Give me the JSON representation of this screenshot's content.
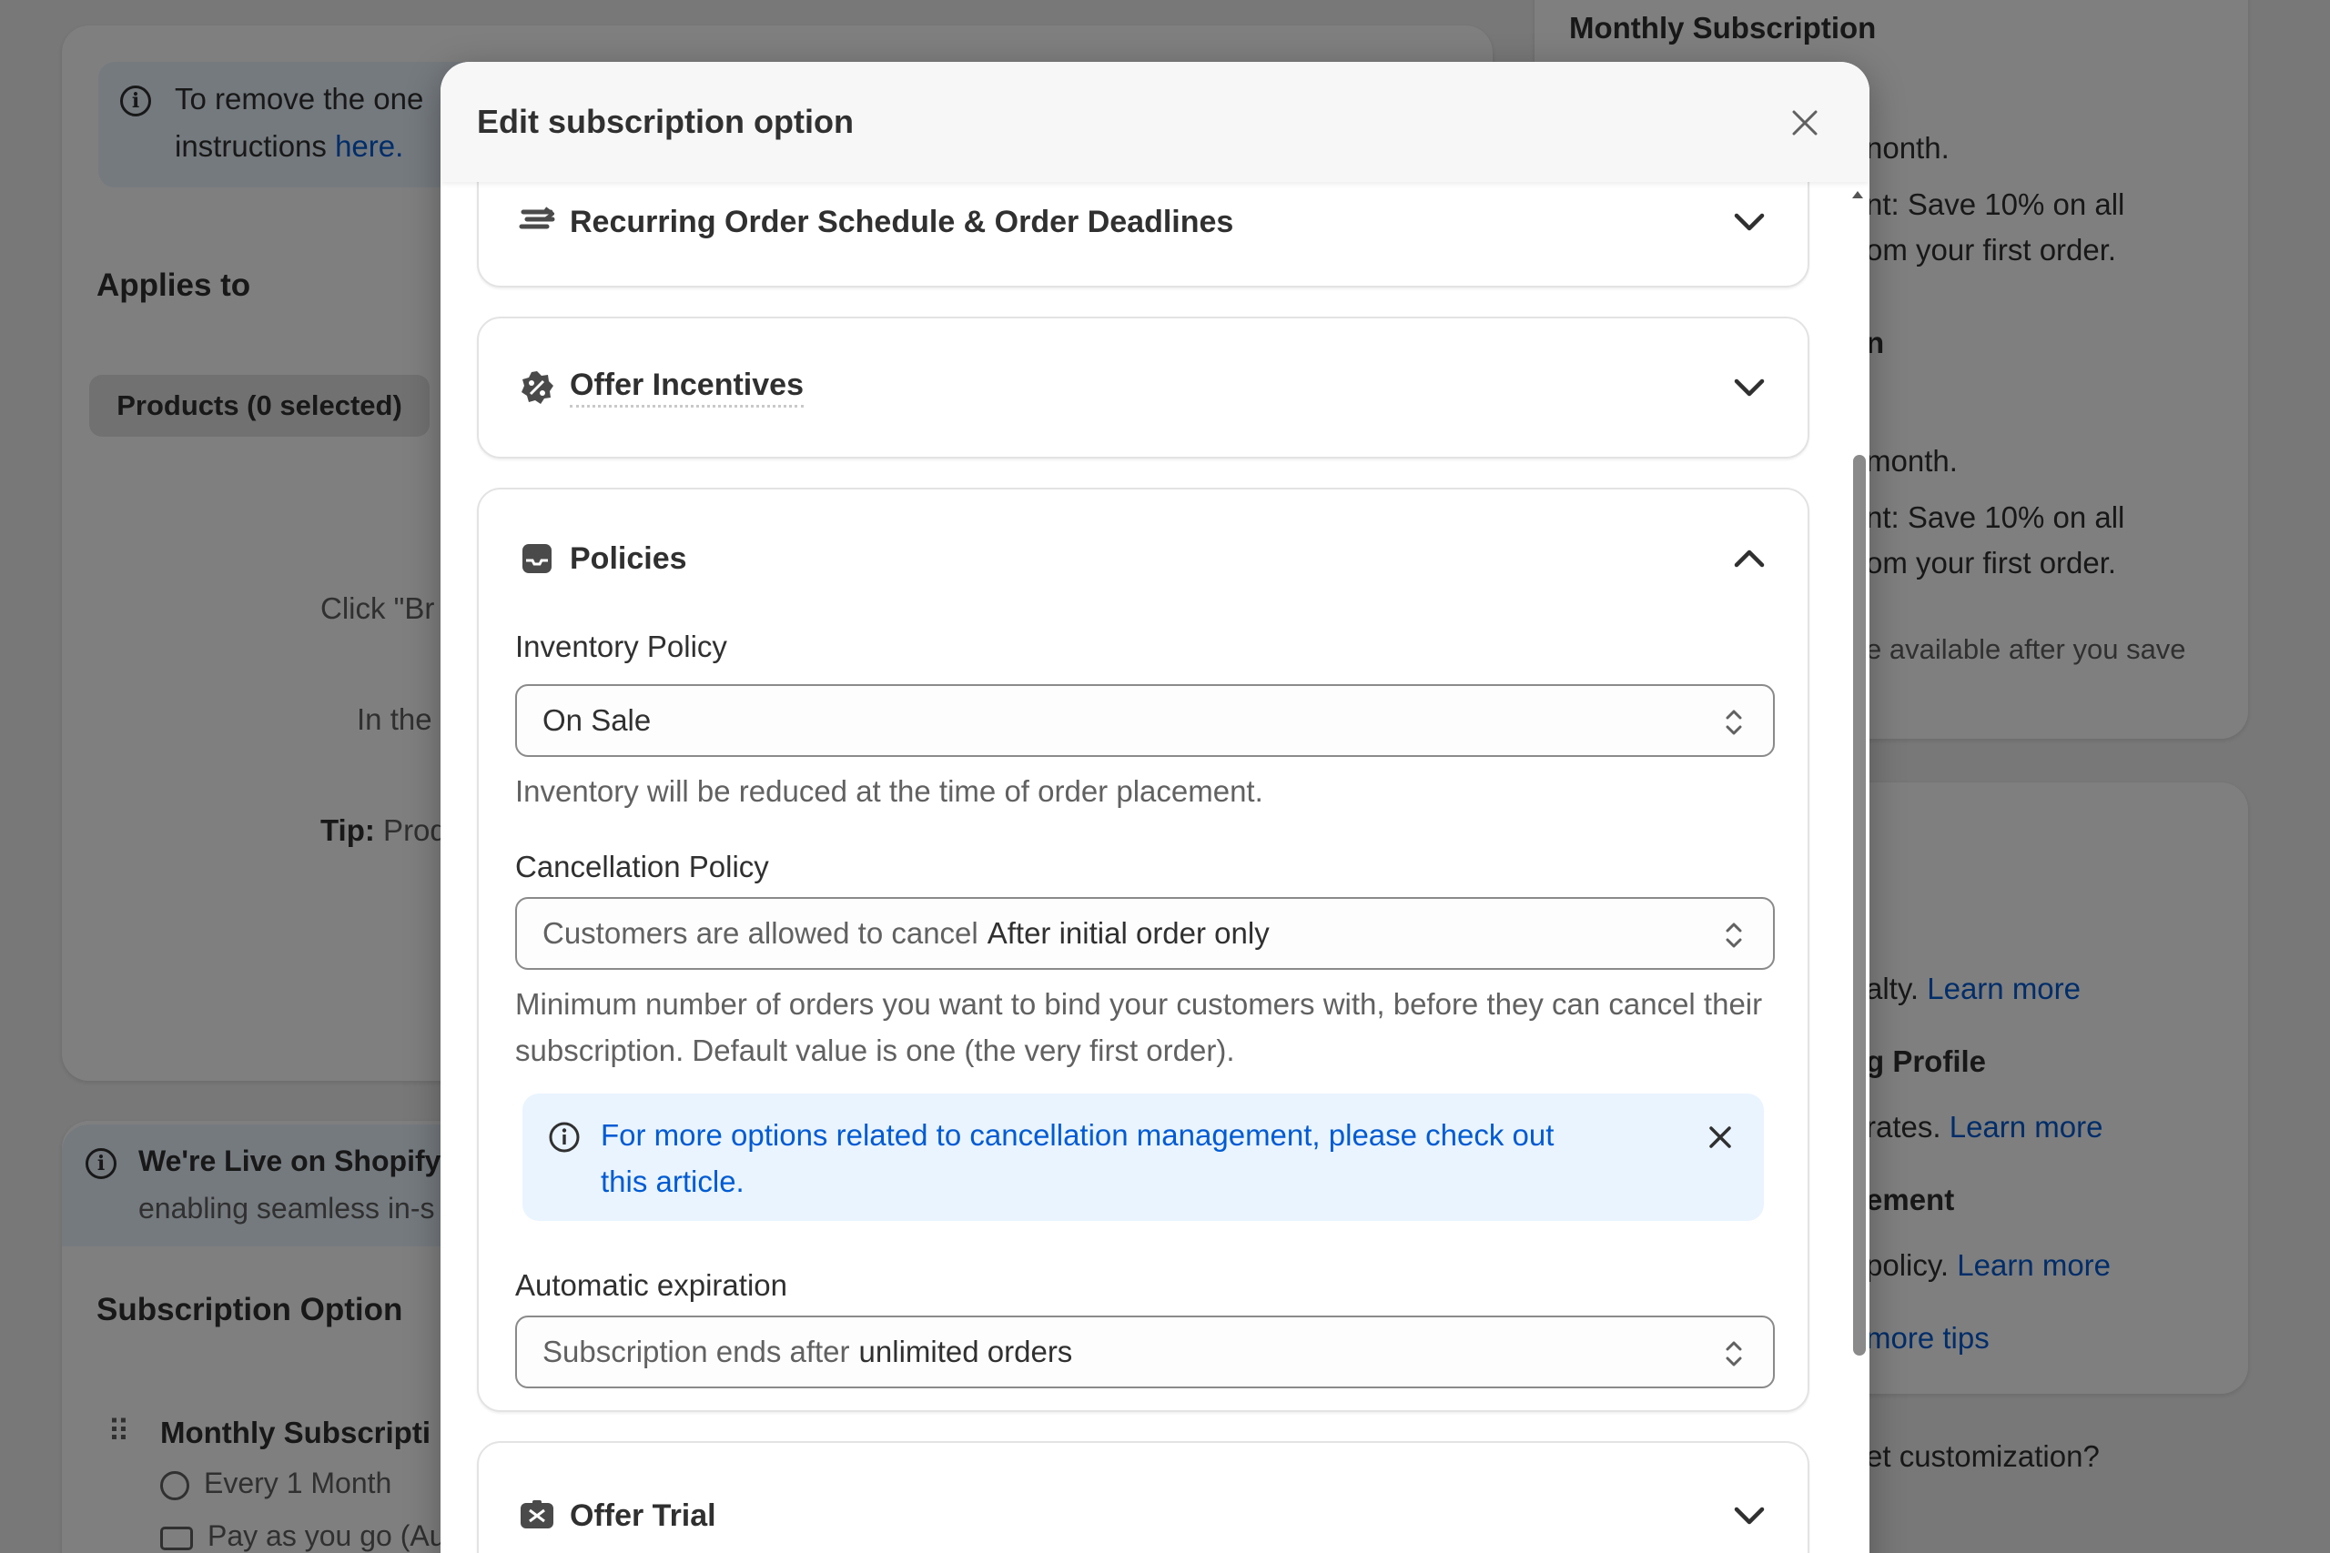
{
  "background": {
    "left_banner": {
      "line1": "To remove the one",
      "line2_text": "instructions",
      "line2_link": "here."
    },
    "applies_to": "Applies to",
    "products_chip": "Products (0 selected)",
    "click_text": "Click \"Br",
    "in_the": "In the",
    "tip_label": "Tip:",
    "tip_text": " Prod",
    "live_banner": {
      "title": "We're Live on Shopify",
      "subtitle": "enabling seamless in-s"
    },
    "subscription_option": "Subscription Option",
    "monthly_item": {
      "title": "Monthly Subscripti",
      "frequency": "Every 1 Month",
      "payment": "Pay as you go (Au"
    },
    "right_panel": {
      "title": "Monthly Subscription",
      "r1": "nonth.",
      "r2": "nt: Save 10% on all",
      "r3": "om your first order.",
      "r4": "n",
      "r5": "month.",
      "r6": "nt: Save 10% on all",
      "r7": "om your first order.",
      "r8": "e available after you save",
      "r9_text": "alty.",
      "r9_link": "Learn more",
      "r10": "g Profile",
      "r11_text": "rates.",
      "r11_link": "Learn more",
      "r12": "ement",
      "r13_text": "policy.",
      "r13_link": "Learn more",
      "r14_link": "more tips",
      "r15": "et customization?"
    }
  },
  "modal": {
    "title": "Edit subscription option",
    "close_icon": "close-icon",
    "sections": {
      "recurring": {
        "title": "Recurring Order Schedule & Order Deadlines",
        "icon": "schedule-icon"
      },
      "incentives": {
        "title": "Offer Incentives",
        "icon": "discount-badge-icon"
      },
      "policies": {
        "title": "Policies",
        "icon": "inbox-icon",
        "inventory": {
          "label": "Inventory Policy",
          "value": "On Sale",
          "help": "Inventory will be reduced at the time of order placement."
        },
        "cancellation": {
          "label": "Cancellation Policy",
          "prefix": "Customers are allowed to cancel",
          "value": "After initial order only",
          "help": "Minimum number of orders you want to bind your customers with, before they can cancel their subscription. Default value is one (the very first order).",
          "banner_text": "For more options related to cancellation management, please check out",
          "banner_link": "this article."
        },
        "expiration": {
          "label": "Automatic expiration",
          "prefix": "Subscription ends after",
          "value": "unlimited orders"
        }
      },
      "trial": {
        "title": "Offer Trial",
        "icon": "trial-icon"
      }
    }
  },
  "colors": {
    "link": "#005bd3",
    "banner_bg": "#eaf4ff",
    "overlay": "rgba(0,0,0,0.5)"
  }
}
